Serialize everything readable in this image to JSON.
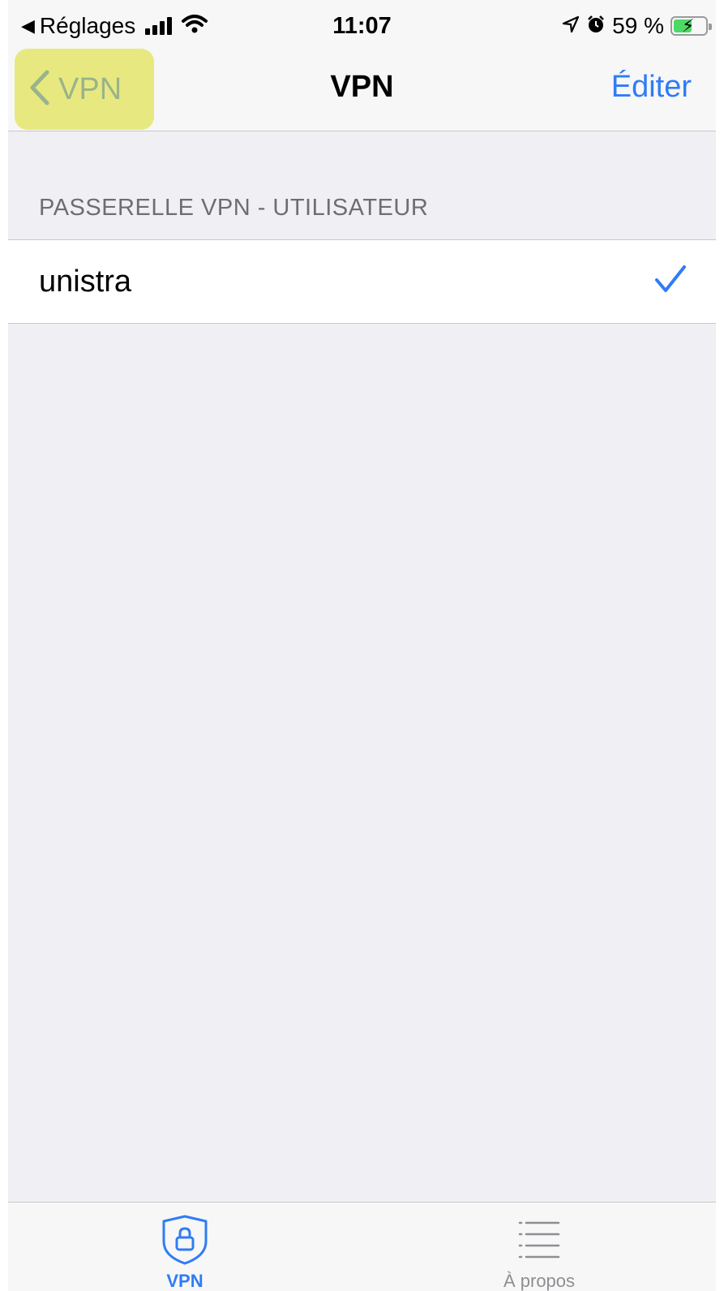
{
  "status_bar": {
    "back_app": "Réglages",
    "time": "11:07",
    "battery_percent": "59 %",
    "battery_level": 0.59,
    "icons": [
      "back-triangle-icon",
      "signal-icon",
      "wifi-icon",
      "location-arrow-icon",
      "alarm-icon",
      "battery-charging-icon"
    ]
  },
  "nav": {
    "back_label": "VPN",
    "title": "VPN",
    "edit_label": "Éditer",
    "accent_color": "#2f7cf6",
    "highlight_color": "#e7e980"
  },
  "section": {
    "header": "PASSERELLE VPN - UTILISATEUR",
    "items": [
      {
        "label": "unistra",
        "selected": true
      }
    ]
  },
  "tabbar": {
    "tabs": [
      {
        "label": "VPN",
        "icon": "shield-lock-icon",
        "active": true
      },
      {
        "label": "À propos",
        "icon": "list-icon",
        "active": false
      }
    ]
  }
}
